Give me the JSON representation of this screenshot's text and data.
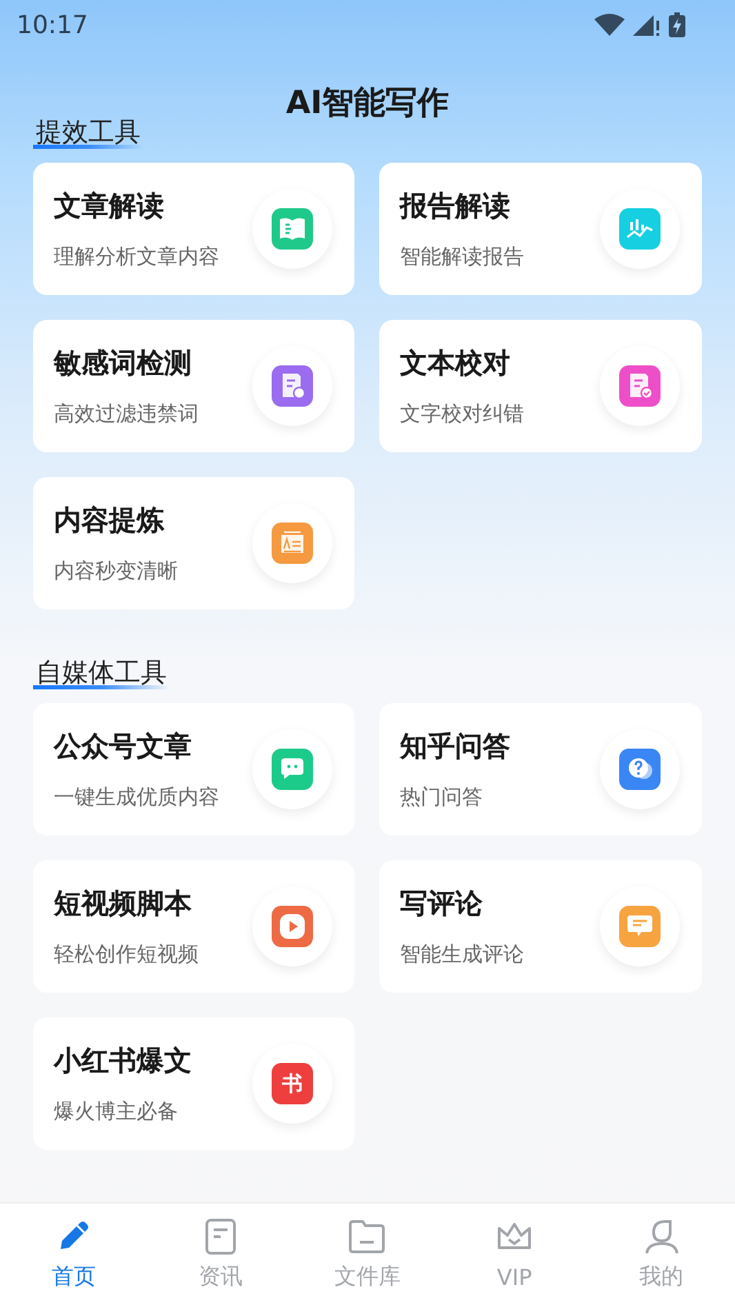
{
  "status_bar": {
    "time": "10:17"
  },
  "header": {
    "title": "AI智能写作"
  },
  "sections": [
    {
      "title": "提效工具",
      "tools": [
        {
          "title": "文章解读",
          "subtitle": "理解分析文章内容",
          "kind": "book",
          "color": "#1fc98a"
        },
        {
          "title": "报告解读",
          "subtitle": "智能解读报告",
          "kind": "chart",
          "color": "#16cfe0"
        },
        {
          "title": "敏感词检测",
          "subtitle": "高效过滤违禁词",
          "kind": "search",
          "color": "#9b6cf0"
        },
        {
          "title": "文本校对",
          "subtitle": "文字校对纠错",
          "kind": "check",
          "color": "#ee4fc8"
        },
        {
          "title": "内容提炼",
          "subtitle": "内容秒变清晰",
          "kind": "article",
          "color": "#f59a40"
        }
      ]
    },
    {
      "title": "自媒体工具",
      "tools": [
        {
          "title": "公众号文章",
          "subtitle": "一键生成优质内容",
          "kind": "chat",
          "color": "#1ccb8a"
        },
        {
          "title": "知乎问答",
          "subtitle": "热门问答",
          "kind": "question",
          "color": "#3a86f5"
        },
        {
          "title": "短视频脚本",
          "subtitle": "轻松创作短视频",
          "kind": "play",
          "color": "#ee6a45"
        },
        {
          "title": "写评论",
          "subtitle": "智能生成评论",
          "kind": "comment",
          "color": "#f7a440"
        },
        {
          "title": "小红书爆文",
          "subtitle": "爆火博主必备",
          "kind": "glyph",
          "glyph": "书",
          "color": "#ee3e3e"
        }
      ]
    }
  ],
  "nav": [
    {
      "label": "首页",
      "kind": "pencil",
      "selected": true
    },
    {
      "label": "资讯",
      "kind": "doc",
      "selected": false
    },
    {
      "label": "文件库",
      "kind": "folder",
      "selected": false
    },
    {
      "label": "VIP",
      "kind": "crown",
      "selected": false
    },
    {
      "label": "我的",
      "kind": "person",
      "selected": false
    }
  ]
}
